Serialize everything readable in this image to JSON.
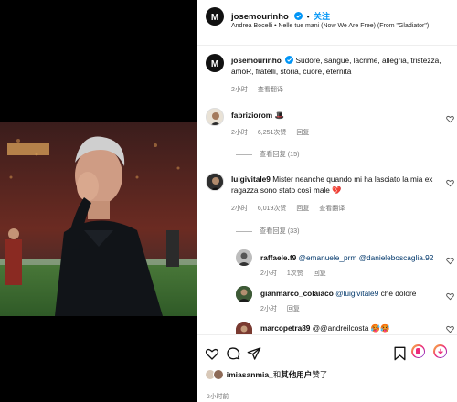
{
  "post": {
    "username": "josemourinho",
    "follow_label": "关注",
    "separator": "•",
    "audio": "Andrea Bocelli • Nelle tue mani (Now We Are Free) (From \"Gladiator\")"
  },
  "caption": {
    "username": "josemourinho",
    "text": "Sudore, sangue, lacrime, allegria, tristezza, amoR, fratelli, storia, cuore, eternità",
    "time": "2小时",
    "translate": "查看翻译"
  },
  "comments": [
    {
      "username": "fabriziorom",
      "text": "🎩",
      "time": "2小时",
      "likes": "6,251次赞",
      "reply": "回复",
      "view_replies": "查看回复 (15)"
    },
    {
      "username": "luigivitale9",
      "text": "Mister neanche quando mi ha lasciato la mia ex ragazza sono stato così male 💔",
      "time": "2小时",
      "likes": "6,019次赞",
      "reply": "回复",
      "translate": "查看翻译",
      "view_replies": "查看回复 (33)"
    }
  ],
  "replies": [
    {
      "username": "raffaele.f9",
      "text": "@emanuele_prm @danieleboscaglia.92",
      "time": "2小时",
      "likes": "1次赞",
      "reply": "回复"
    },
    {
      "username": "gianmarco_colaiaco",
      "mention": "@luigivitale9",
      "text": "che dolore",
      "time": "2小时",
      "reply": "回复"
    },
    {
      "username": "marcopetra89",
      "text": "@@andreilcosta 🥵🥵"
    }
  ],
  "likes_line": {
    "user": "imiasanmia_",
    "connector": "和",
    "others": "其他用户",
    "suffix": "赞了"
  },
  "post_time": "2小时前",
  "icons": [
    "heart-icon",
    "comment-icon",
    "share-icon",
    "bookmark-icon"
  ],
  "colors": {
    "verified": "#0095f6",
    "follow": "#0095f6",
    "link": "#00376b"
  }
}
